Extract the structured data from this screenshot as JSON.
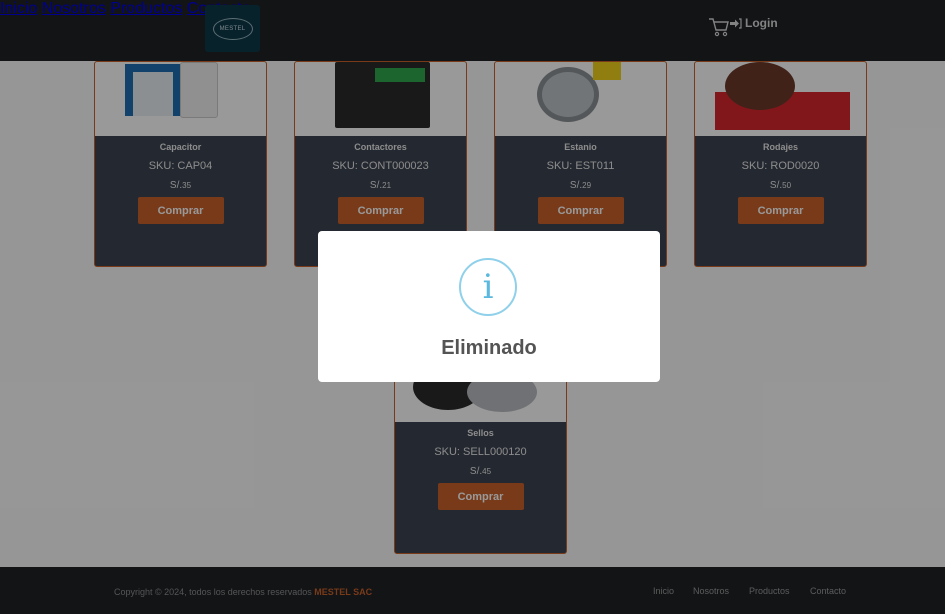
{
  "header": {
    "logo_text": "MESTEL",
    "nav": [
      "Inicio",
      "Nosotros",
      "Productos",
      "Contacto"
    ],
    "login_label": "Login",
    "icons": {
      "cart": "cart-icon",
      "login": "sign-in-icon"
    }
  },
  "products": [
    {
      "name": "Capacitor",
      "sku": "SKU: CAP04",
      "price_prefix": "S/.",
      "price": "35",
      "button": "Comprar",
      "image": "capacitor-image"
    },
    {
      "name": "Contactores",
      "sku": "SKU: CONT000023",
      "price_prefix": "S/.",
      "price": "21",
      "button": "Comprar",
      "image": "contactor-image"
    },
    {
      "name": "Estanio",
      "sku": "SKU: EST011",
      "price_prefix": "S/.",
      "price": "29",
      "button": "Comprar",
      "image": "solder-wire-image"
    },
    {
      "name": "Rodajes",
      "sku": "SKU: ROD0020",
      "price_prefix": "S/.",
      "price": "50",
      "button": "Comprar",
      "image": "bearing-image"
    },
    {
      "name": "Sellos",
      "sku": "SKU: SELL000120",
      "price_prefix": "S/.",
      "price": "45",
      "button": "Comprar",
      "image": "seal-image"
    }
  ],
  "footer": {
    "copyright": "Copyright © 2024, todos los derechos reservados ",
    "brand": "MESTEL SAC",
    "nav": [
      "Inicio",
      "Nosotros",
      "Productos",
      "Contacto"
    ]
  },
  "modal": {
    "icon": "info-icon",
    "icon_glyph": "i",
    "title": "Eliminado"
  },
  "colors": {
    "accent": "#c8612b",
    "header_bg": "#1f2226",
    "card_bg": "#3d4450",
    "info": "#8fd0ea"
  }
}
